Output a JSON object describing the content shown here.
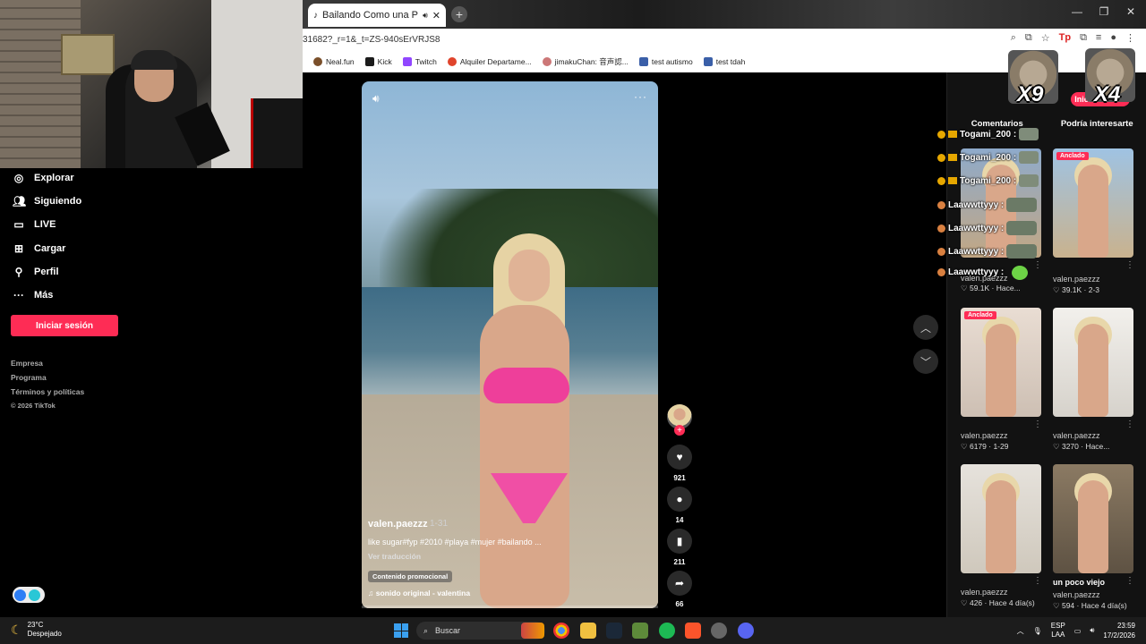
{
  "browser": {
    "tab_title": "Bailando Como una Playa e",
    "url": "31682?_r=1&_t=ZS-940sErVRJS8",
    "bookmarks": [
      {
        "label": "Neal.fun",
        "color": "#7a4f2a"
      },
      {
        "label": "Kick",
        "color": "#1b1b1b"
      },
      {
        "label": "Twitch",
        "color": "#9146ff"
      },
      {
        "label": "Alquiler Departame...",
        "color": "#e0442c"
      },
      {
        "label": "jimakuChan: 音声認...",
        "color": "#c77"
      },
      {
        "label": "test autismo",
        "color": "#3a5fa8"
      },
      {
        "label": "test tdah",
        "color": "#3a5fa8"
      }
    ]
  },
  "sidebar": {
    "items": [
      {
        "label": "Explorar",
        "icon": "compass-icon"
      },
      {
        "label": "Siguiendo",
        "icon": "people-icon"
      },
      {
        "label": "LIVE",
        "icon": "live-icon"
      },
      {
        "label": "Cargar",
        "icon": "upload-icon"
      },
      {
        "label": "Perfil",
        "icon": "user-icon"
      },
      {
        "label": "Más",
        "icon": "more-icon"
      }
    ],
    "login_button": "Iniciar sesión",
    "footer": [
      "Empresa",
      "Programa",
      "Términos y políticas",
      "© 2026 TikTok"
    ]
  },
  "video": {
    "username": "valen.paezzz",
    "date": "1-31",
    "caption": "like sugar#fyp #2010 #playa #mujer #bailando ...",
    "translate": "Ver traducción",
    "promo": "Contenido promocional",
    "sound": "sonido original - valentina",
    "likes": "921",
    "comments": "14",
    "saves": "211",
    "shares": "66"
  },
  "right_panel": {
    "login_button": "Iniciar sesión",
    "tabs": [
      "Comentarios",
      "Podría interesarte"
    ],
    "videos": [
      {
        "badge": "",
        "title": "",
        "user": "valen.paezzz",
        "meta": "♡ 59.1K · Hace..."
      },
      {
        "badge": "Anclado",
        "title": "",
        "user": "valen.paezzz",
        "meta": "♡ 39.1K · 2-3"
      },
      {
        "badge": "Anclado",
        "title": "",
        "user": "valen.paezzz",
        "meta": "♡ 6179 · 1-29"
      },
      {
        "badge": "",
        "title": "",
        "user": "valen.paezzz",
        "meta": "♡ 3270 · Hace..."
      },
      {
        "badge": "",
        "title": "",
        "user": "valen.paezzz",
        "meta": "♡ 426 · Hace 4 día(s)"
      },
      {
        "badge": "",
        "title": "un poco viejo",
        "user": "valen.paezzz",
        "meta": "♡ 594 · Hace 4 día(s)"
      }
    ]
  },
  "chat": [
    {
      "name": "Togami_200 :"
    },
    {
      "name": "Togami_200 :"
    },
    {
      "name": "Togami_200 :"
    },
    {
      "name": "Laawwttyyy :"
    },
    {
      "name": "Laawwttyyy :"
    },
    {
      "name": "Laawwttyyy :"
    },
    {
      "name": "Laawwttyyy :"
    }
  ],
  "overlays": {
    "cat1": "X9",
    "cat2": "X4"
  },
  "taskbar": {
    "temp": "23°C",
    "weather": "Despejado",
    "search": "Buscar",
    "lang1": "ESP",
    "lang2": "LAA",
    "time": "23:59",
    "date": "17/2/2026"
  }
}
